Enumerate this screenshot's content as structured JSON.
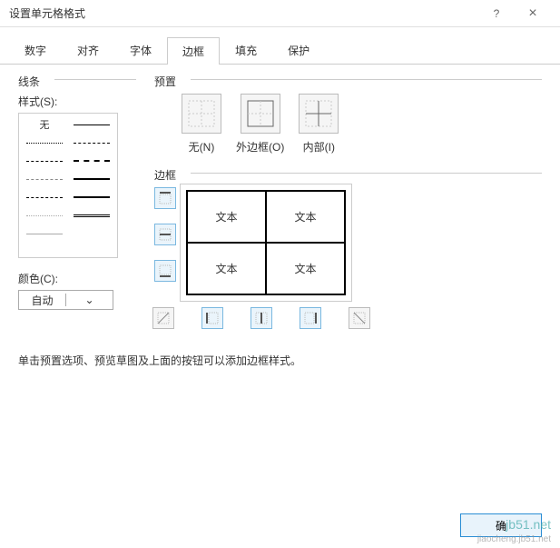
{
  "window": {
    "title": "设置单元格格式",
    "help": "?",
    "close": "×"
  },
  "tabs": [
    "数字",
    "对齐",
    "字体",
    "边框",
    "填充",
    "保护"
  ],
  "active_tab": "边框",
  "lines": {
    "legend": "线条",
    "style_label": "样式(S):",
    "none_label": "无",
    "color_label": "颜色(C):",
    "color_value": "自动"
  },
  "presets": {
    "legend": "预置",
    "items": [
      {
        "key": "none",
        "label": "无(N)"
      },
      {
        "key": "outline",
        "label": "外边框(O)"
      },
      {
        "key": "inside",
        "label": "内部(I)"
      }
    ]
  },
  "border": {
    "legend": "边框",
    "cell_text": "文本"
  },
  "instruction": "单击预置选项、预览草图及上面的按钮可以添加边框样式。",
  "footer": {
    "ok_partial": "确"
  },
  "watermark": {
    "big": "jb51.net",
    "small": "jiaocheng.jb51.net"
  }
}
